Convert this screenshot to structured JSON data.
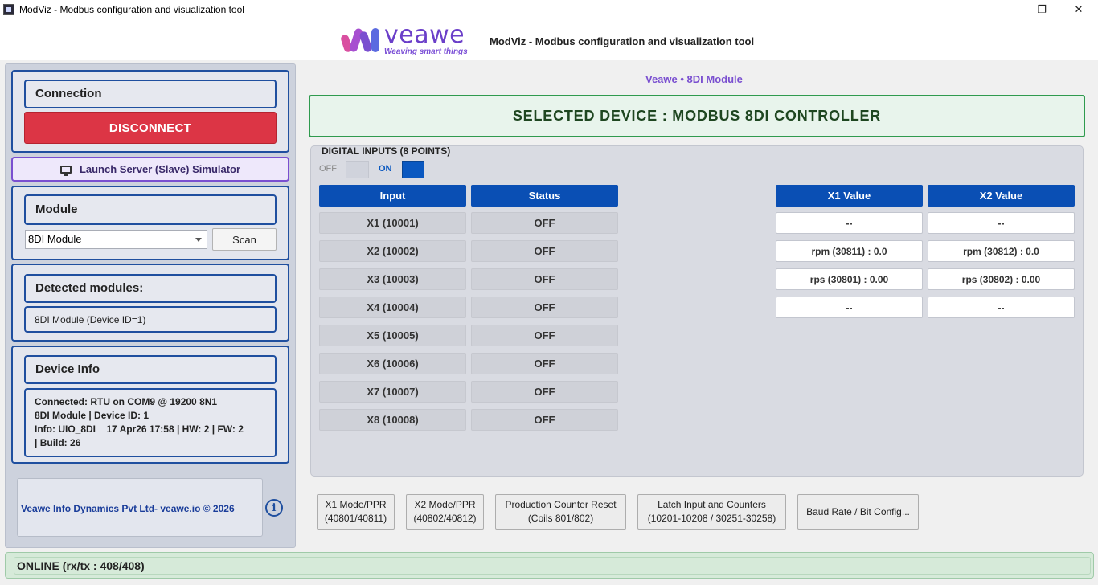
{
  "window": {
    "title": "ModViz - Modbus configuration and visualization tool",
    "min_icon": "—",
    "max_icon": "❐",
    "close_icon": "✕"
  },
  "header": {
    "logo_word": "veawe",
    "logo_tagline": "Weaving smart things",
    "title": "ModViz - Modbus configuration and visualization tool"
  },
  "sidebar": {
    "connection_title": "Connection",
    "disconnect_label": "DISCONNECT",
    "simulator_label": "Launch Server (Slave) Simulator",
    "module_title": "Module",
    "module_selected": "8DI Module",
    "scan_label": "Scan",
    "detected_title": "Detected modules:",
    "detected_item": "8DI Module (Device ID=1)",
    "device_info_title": "Device Info",
    "device_info_lines": [
      "Connected: RTU on COM9 @ 19200 8N1",
      "8DI Module | Device ID: 1",
      "Info: UIO_8DI    17 Apr26 17:58 | HW: 2 | FW: 2",
      "| Build: 26"
    ],
    "footer_link": "Veawe Info Dynamics Pvt Ltd- veawe.io © 2026",
    "info_icon": "i"
  },
  "main": {
    "breadcrumb": "Veawe • 8DI Module",
    "selected_device": "SELECTED DEVICE : MODBUS 8DI CONTROLLER",
    "panel_title": "DIGITAL INPUTS (8 POINTS)",
    "legend_off": "OFF",
    "legend_on": "ON",
    "colors": {
      "on": "#0a58c0",
      "off": "#d0d3dc"
    },
    "columns": {
      "input": "Input",
      "status": "Status",
      "x1": "X1 Value",
      "x2": "X2 Value"
    },
    "inputs": [
      {
        "label": "X1 (10001)",
        "status": "OFF"
      },
      {
        "label": "X2 (10002)",
        "status": "OFF"
      },
      {
        "label": "X3 (10003)",
        "status": "OFF"
      },
      {
        "label": "X4 (10004)",
        "status": "OFF"
      },
      {
        "label": "X5 (10005)",
        "status": "OFF"
      },
      {
        "label": "X6 (10006)",
        "status": "OFF"
      },
      {
        "label": "X7 (10007)",
        "status": "OFF"
      },
      {
        "label": "X8 (10008)",
        "status": "OFF"
      }
    ],
    "values": [
      {
        "x1": "--",
        "x2": "--"
      },
      {
        "x1": "rpm (30811) : 0.0",
        "x2": "rpm (30812) : 0.0"
      },
      {
        "x1": "rps (30801) : 0.00",
        "x2": "rps (30802) : 0.00"
      },
      {
        "x1": "--",
        "x2": "--"
      }
    ]
  },
  "actions": [
    {
      "line1": "X1 Mode/PPR",
      "line2": "(40801/40811)"
    },
    {
      "line1": "X2 Mode/PPR",
      "line2": "(40802/40812)"
    },
    {
      "line1": "Production Counter Reset",
      "line2": "(Coils 801/802)"
    },
    {
      "line1": "Latch Input and Counters",
      "line2": "(10201-10208 / 30251-30258)"
    },
    {
      "line1": "Baud Rate / Bit Config...",
      "line2": ""
    }
  ],
  "status_bar": {
    "text": "ONLINE (rx/tx : 408/408)"
  }
}
